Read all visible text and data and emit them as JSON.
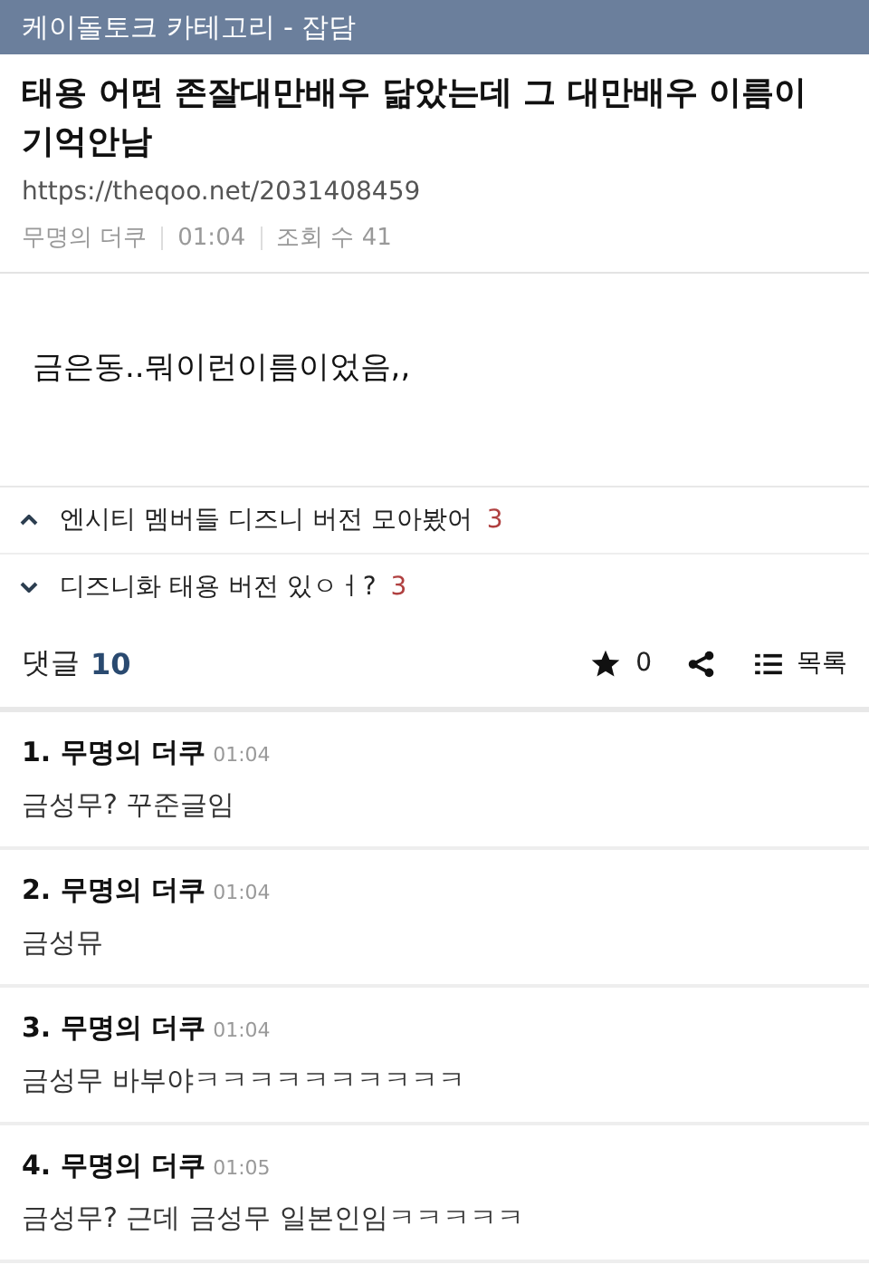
{
  "header": {
    "title": "케이돌토크 카테고리 - 잡담"
  },
  "post": {
    "title": "태용 어떤 존잘대만배우 닮았는데 그 대만배우 이름이 기억안남",
    "url": "https://theqoo.net/2031408459",
    "author": "무명의 더쿠",
    "time": "01:04",
    "views": "조회 수 41",
    "body": "금은동..뭐이런이름이었음,,"
  },
  "nav": [
    {
      "kind": "prev",
      "title": "엔시티 멤버들 디즈니 버전 모아봤어",
      "count": "3"
    },
    {
      "kind": "next",
      "title": "디즈니화 태용 버전 있ㅇㅓ?",
      "count": "3"
    }
  ],
  "comment_bar": {
    "label": "댓글",
    "count": "10",
    "stars": "0",
    "list_label": "목록"
  },
  "comments": [
    {
      "number": "1.",
      "author": "무명의 더쿠",
      "time": "01:04",
      "text": "금성무? 꾸준글임"
    },
    {
      "number": "2.",
      "author": "무명의 더쿠",
      "time": "01:04",
      "text": "금성뮤"
    },
    {
      "number": "3.",
      "author": "무명의 더쿠",
      "time": "01:04",
      "text": "금성무 바부야ㅋㅋㅋㅋㅋㅋㅋㅋㅋㅋ"
    },
    {
      "number": "4.",
      "author": "무명의 더쿠",
      "time": "01:05",
      "text": "금성무? 근데 금성무 일본인임ㅋㅋㅋㅋㅋ"
    }
  ]
}
